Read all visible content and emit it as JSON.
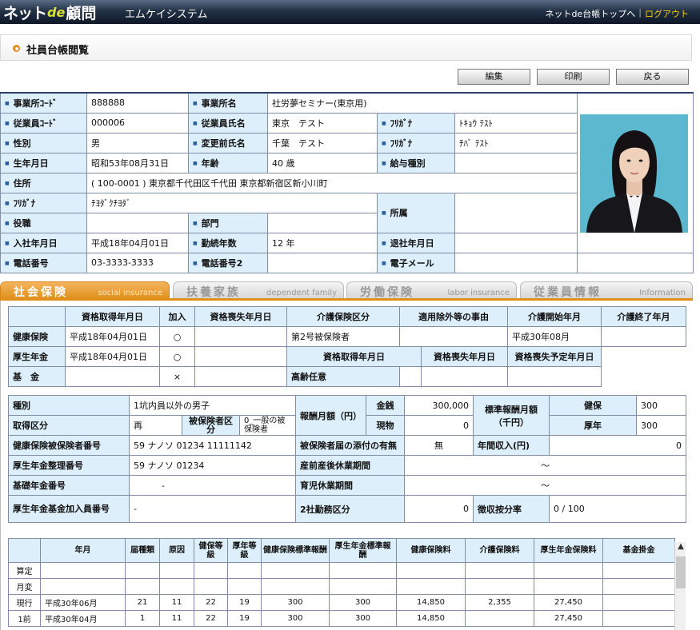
{
  "header": {
    "logo_a": "ネット",
    "logo_b": "de",
    "logo_c": "顧問",
    "system": "エムケイシステム",
    "top_link": "ネットde台帳トップへ",
    "sep": "|",
    "logout": "ログアウト"
  },
  "page_title": "社員台帳閲覧",
  "buttons": {
    "edit": "編集",
    "print": "印刷",
    "back": "戻る"
  },
  "basic": {
    "office_code_l": "事業所ｺｰﾄﾞ",
    "office_code": "888888",
    "office_name_l": "事業所名",
    "office_name": "社労夢セミナー(東京用)",
    "emp_code_l": "従業員ｺｰﾄﾞ",
    "emp_code": "000006",
    "emp_name_l": "従業員氏名",
    "emp_name": "東京　テスト",
    "kana_l": "ﾌﾘｶﾞﾅ",
    "kana": "ﾄｷｮｳ ﾃｽﾄ",
    "sex_l": "性別",
    "sex": "男",
    "prev_name_l": "変更前氏名",
    "prev_name": "千葉　テスト",
    "prev_kana_l": "ﾌﾘｶﾞﾅ",
    "prev_kana": "ﾁﾊﾞ ﾃｽﾄ",
    "birth_l": "生年月日",
    "birth": "昭和53年08月31日",
    "age_l": "年齢",
    "age": "40 歳",
    "salary_type_l": "給与種別",
    "salary_type": "",
    "addr_l": "住所",
    "addr": "( 100-0001 )  東京都千代田区千代田  東京都新宿区新小川町",
    "addr_kana_l": "ﾌﾘｶﾞﾅ",
    "addr_kana": "ﾁﾖﾀﾞｸﾁﾖﾀﾞ",
    "post_l": "役職",
    "post": "",
    "dept_l": "部門",
    "dept": "",
    "aff_l": "所属",
    "aff": "",
    "join_l": "入社年月日",
    "join": "平成18年04月01日",
    "tenure_l": "勤続年数",
    "tenure": "12 年",
    "leave_l": "退社年月日",
    "leave": "",
    "tel_l": "電話番号",
    "tel": "03-3333-3333",
    "tel2_l": "電話番号2",
    "tel2": "",
    "email_l": "電子メール",
    "email": ""
  },
  "tabs": [
    {
      "ja": "社会保険",
      "en": "social insurance"
    },
    {
      "ja": "扶養家族",
      "en": "dependent family"
    },
    {
      "ja": "労働保険",
      "en": "labor insurance"
    },
    {
      "ja": "従業員情報",
      "en": "Information"
    }
  ],
  "ins": {
    "h_get": "資格取得年月日",
    "h_join": "加入",
    "h_lose": "資格喪失年月日",
    "h_care": "介護保険区分",
    "h_excl": "適用除外等の事由",
    "h_cstart": "介護開始年月",
    "h_cend": "介護終了年月",
    "health_l": "健康保険",
    "health_get": "平成18年04月01日",
    "health_join": "○",
    "care_class": "第2号被保険者",
    "care_start": "平成30年08月",
    "pension_l": "厚生年金",
    "pension_get": "平成18年04月01日",
    "pension_join": "○",
    "h2_get": "資格取得年月日",
    "h2_lose": "資格喪失年月日",
    "h2_plan": "資格喪失予定年月日",
    "fund_l": "基　金",
    "fund_join": "×",
    "elder_l": "高齢任意"
  },
  "std": {
    "kind_l": "種別",
    "kind": "1坑内員以外の男子",
    "report_l": "報酬月額（円）",
    "money_l": "金銭",
    "money": "300,000",
    "std_l": "標準報酬月額（千円）",
    "kenpo_l": "健保",
    "kenpo": "300",
    "acq_l": "取得区分",
    "acq": "再",
    "insured_l": "被保険者区分",
    "insured": "0_一般の被保険者",
    "goods_l": "現物",
    "goods": "0",
    "kounen_l": "厚年",
    "kounen": "300",
    "hno_l": "健康保険被保険者番号",
    "hno": "59  ナノソ  01234  11111142",
    "attach_l": "被保険者届の添付の有無",
    "attach": "無",
    "annual_l": "年間収入(円)",
    "annual": "0",
    "pno_l": "厚生年金整理番号",
    "pno": "59  ナノソ  01234",
    "mat_l": "産前産後休業期間",
    "mat": "～",
    "basic_l": "基礎年金番号",
    "basic": "-",
    "child_l": "育児休業期間",
    "child": "～",
    "fund_l": "厚生年金基金加入員番号",
    "fund": "-",
    "two_l": "2社勤務区分",
    "two": "0",
    "collect_l": "徴収按分率",
    "collect": "0  /  100"
  },
  "hist": {
    "headers": [
      "",
      "年月",
      "届種類",
      "原因",
      "健保等級",
      "厚年等級",
      "健康保険標準報酬",
      "厚生年金標準報酬",
      "健康保険料",
      "介護保険料",
      "厚生年金保険料",
      "基金掛金"
    ],
    "rows": [
      [
        "算定",
        "",
        "",
        "",
        "",
        "",
        "",
        "",
        "",
        "",
        "",
        ""
      ],
      [
        "月変",
        "",
        "",
        "",
        "",
        "",
        "",
        "",
        "",
        "",
        "",
        ""
      ],
      [
        "現行",
        "平成30年06月",
        "21",
        "11",
        "22",
        "19",
        "300",
        "300",
        "14,850",
        "2,355",
        "27,450",
        ""
      ],
      [
        "1前",
        "平成30年04月",
        "1",
        "11",
        "22",
        "19",
        "300",
        "300",
        "14,850",
        "",
        "27,450",
        ""
      ]
    ]
  }
}
